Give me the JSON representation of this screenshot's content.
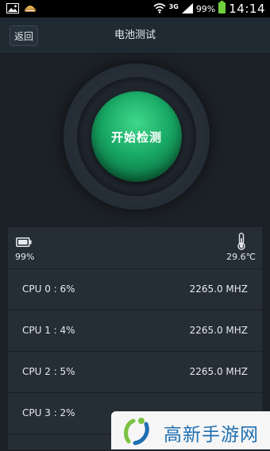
{
  "status_bar": {
    "network_type": "3G",
    "battery_percent": "99%",
    "time": "14:14"
  },
  "title_bar": {
    "back_label": "返回",
    "title": "电池测试"
  },
  "start_button": {
    "label": "开始检测"
  },
  "info": {
    "battery_percent": "99%",
    "temperature": "29.6℃"
  },
  "cpus": [
    {
      "name": "CPU  0 : 6%",
      "freq": "2265.0 MHZ"
    },
    {
      "name": "CPU  1 : 4%",
      "freq": "2265.0 MHZ"
    },
    {
      "name": "CPU  2 : 5%",
      "freq": "2265.0 MHZ"
    },
    {
      "name": "CPU  3 : 2%",
      "freq": ""
    }
  ],
  "watermark": {
    "text": "高新手游网"
  },
  "icons": {
    "gallery": "image-icon",
    "notification": "notification-icon",
    "wifi": "wifi-icon",
    "signal": "signal-icon",
    "battery": "battery-icon",
    "thermometer": "thermometer-icon"
  },
  "colors": {
    "accent_green": "#18a865",
    "background": "#1c2127",
    "panel": "#252d35",
    "watermark_blue": "#1f6fb0",
    "watermark_green": "#7cc242"
  }
}
